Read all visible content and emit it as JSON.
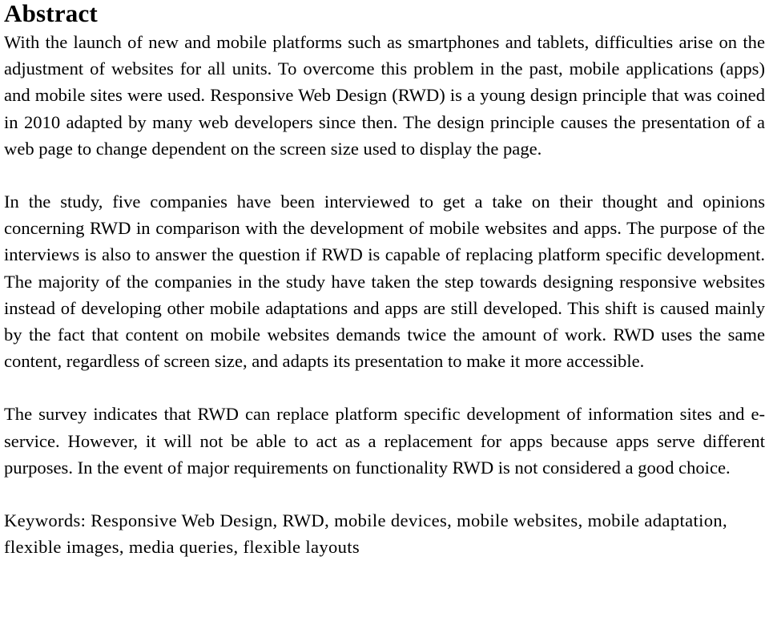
{
  "document": {
    "heading": "Abstract",
    "paragraphs": [
      "With the launch of new and mobile platforms such as smartphones and tablets, difficulties arise on the adjustment of websites for all units. To overcome this problem in the past, mobile applications (apps) and mobile sites were used. Responsive Web Design (RWD) is a young design principle that was coined in 2010 adapted by many web developers since then. The design principle causes the presentation of a web page to change dependent on the screen size used to display the page.",
      "In the study, five companies have been interviewed to get a take on their thought and opinions concerning RWD in comparison with the development of mobile websites and apps. The purpose of the interviews is also to answer the question if RWD is capable of replacing platform specific development.  The majority of the companies in the study have taken the step towards designing responsive websites instead of developing other mobile adaptations and apps are still developed. This shift is caused mainly by the fact that content on mobile websites demands twice the amount of work. RWD uses the same content, regardless of screen size, and adapts its presentation to make it more accessible.",
      "The survey indicates that RWD can replace platform specific development of information sites and e-service. However, it will not be able to act as a replacement for apps because apps serve different purposes. In the event of major requirements on functionality RWD is not considered a good choice."
    ],
    "keywords": {
      "label": "Keywords:",
      "text": "Keywords: Responsive Web Design, RWD, mobile devices, mobile websites, mobile adaptation, flexible images, media queries, flexible layouts",
      "terms": [
        "Responsive Web Design",
        "RWD",
        "mobile devices",
        "mobile websites",
        "mobile adaptation",
        "flexible images",
        "media queries",
        "flexible layouts"
      ]
    },
    "colors": {
      "text": "#000000",
      "background": "#ffffff"
    }
  }
}
